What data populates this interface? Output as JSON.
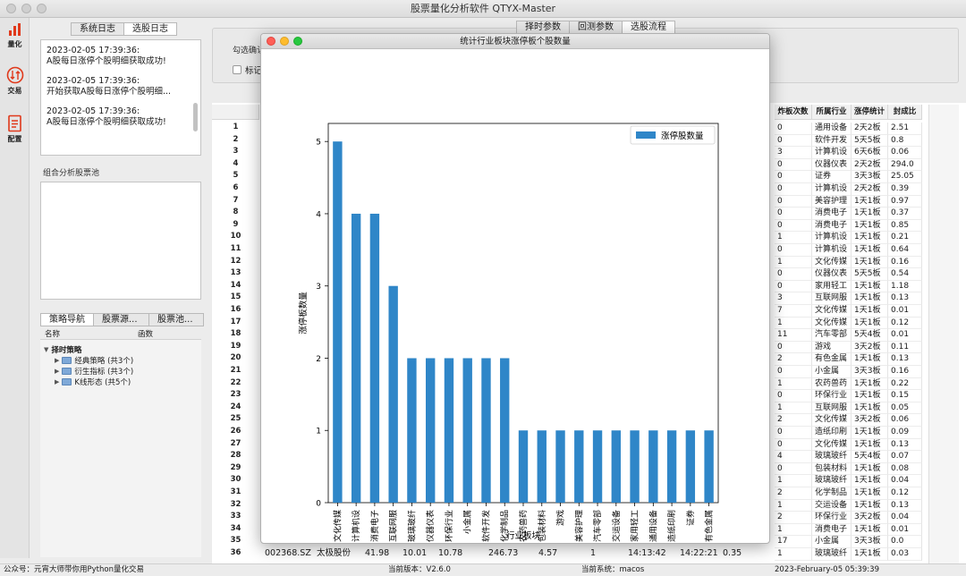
{
  "window": {
    "title": "股票量化分析软件 QTYX-Master"
  },
  "iconbar": [
    {
      "label": "量化",
      "icon": "bar-chart-icon"
    },
    {
      "label": "交易",
      "icon": "trade-arrows-icon"
    },
    {
      "label": "配置",
      "icon": "document-icon"
    }
  ],
  "left": {
    "log_tabs": [
      "系统日志",
      "选股日志"
    ],
    "log_entries": [
      {
        "time": "2023-02-05 17:39:36:",
        "text": "A股每日涨停个股明细获取成功!"
      },
      {
        "time": "2023-02-05 17:39:36:",
        "text": "开始获取A股每日涨停个股明细..."
      },
      {
        "time": "2023-02-05 17:39:36:",
        "text": "A股每日涨停个股明细获取成功!"
      }
    ],
    "pool_label": "组合分析股票池",
    "nav_tabs": [
      "策略导航",
      "股票源...",
      "股票池..."
    ],
    "tree_headers": [
      "名称",
      "函数"
    ],
    "tree_root": "择时策略",
    "tree_children": [
      "经典策略 (共3个)",
      "衍生指标 (共3个)",
      "K线形态 (共5个)"
    ]
  },
  "right": {
    "tabs": [
      "择时参数",
      "回测参数",
      "选股流程"
    ],
    "confirm_label": "勾选确认",
    "checkbox_label": "标记",
    "headers": [
      "炸板次数",
      "所属行业",
      "涨停统计",
      "封成比"
    ],
    "row_numbers": [
      "1",
      "2",
      "3",
      "4",
      "5",
      "6",
      "7",
      "8",
      "9",
      "10",
      "11",
      "12",
      "13",
      "14",
      "15",
      "16",
      "17",
      "18",
      "19",
      "20",
      "21",
      "22",
      "23",
      "24",
      "25",
      "26",
      "27",
      "28",
      "29",
      "30",
      "31",
      "32",
      "33",
      "34",
      "35",
      "36"
    ],
    "rows": [
      [
        "0",
        "通用设备",
        "2天2板",
        "2.51"
      ],
      [
        "0",
        "软件开发",
        "5天5板",
        "0.8"
      ],
      [
        "3",
        "计算机设",
        "6天6板",
        "0.06"
      ],
      [
        "0",
        "仪器仪表",
        "2天2板",
        "294.0"
      ],
      [
        "0",
        "证券",
        "3天3板",
        "25.05"
      ],
      [
        "0",
        "计算机设",
        "2天2板",
        "0.39"
      ],
      [
        "0",
        "美容护理",
        "1天1板",
        "0.97"
      ],
      [
        "0",
        "消费电子",
        "1天1板",
        "0.37"
      ],
      [
        "0",
        "消费电子",
        "1天1板",
        "0.85"
      ],
      [
        "1",
        "计算机设",
        "1天1板",
        "0.21"
      ],
      [
        "0",
        "计算机设",
        "1天1板",
        "0.64"
      ],
      [
        "1",
        "文化传媒",
        "1天1板",
        "0.16"
      ],
      [
        "0",
        "仪器仪表",
        "5天5板",
        "0.54"
      ],
      [
        "0",
        "家用轻工",
        "1天1板",
        "1.18"
      ],
      [
        "3",
        "互联网服",
        "1天1板",
        "0.13"
      ],
      [
        "7",
        "文化传媒",
        "1天1板",
        "0.01"
      ],
      [
        "1",
        "文化传媒",
        "1天1板",
        "0.12"
      ],
      [
        "11",
        "汽车零部",
        "5天4板",
        "0.01"
      ],
      [
        "0",
        "游戏",
        "3天2板",
        "0.11"
      ],
      [
        "2",
        "有色金属",
        "1天1板",
        "0.13"
      ],
      [
        "0",
        "小金属",
        "3天3板",
        "0.16"
      ],
      [
        "1",
        "农药兽药",
        "1天1板",
        "0.22"
      ],
      [
        "0",
        "环保行业",
        "1天1板",
        "0.15"
      ],
      [
        "1",
        "互联网服",
        "1天1板",
        "0.05"
      ],
      [
        "2",
        "文化传媒",
        "3天2板",
        "0.06"
      ],
      [
        "0",
        "造纸印刷",
        "1天1板",
        "0.09"
      ],
      [
        "0",
        "文化传媒",
        "1天1板",
        "0.13"
      ],
      [
        "4",
        "玻璃玻纤",
        "5天4板",
        "0.07"
      ],
      [
        "0",
        "包装材料",
        "1天1板",
        "0.08"
      ],
      [
        "1",
        "玻璃玻纤",
        "1天1板",
        "0.04"
      ],
      [
        "2",
        "化学制品",
        "1天1板",
        "0.12"
      ],
      [
        "1",
        "交运设备",
        "1天1板",
        "0.13"
      ],
      [
        "2",
        "环保行业",
        "3天2板",
        "0.04"
      ],
      [
        "1",
        "消费电子",
        "1天1板",
        "0.01"
      ],
      [
        "17",
        "小金属",
        "3天3板",
        "0.0"
      ],
      [
        "1",
        "玻璃玻纤",
        "1天1板",
        "0.03"
      ]
    ],
    "last_row": [
      "002368.SZ",
      "太极股份",
      "41.98",
      "10.01",
      "10.78",
      "246.73",
      "4.57",
      "1",
      "14:13:42",
      "14:22:21",
      "0.35"
    ]
  },
  "popup": {
    "title": "统计行业板块涨停板个股数量"
  },
  "chart_data": {
    "type": "bar",
    "categories": [
      "文化传媒",
      "计算机设",
      "消费电子",
      "互联网服",
      "玻璃玻纤",
      "仪器仪表",
      "环保行业",
      "小金属",
      "软件开发",
      "化学制品",
      "农药兽药",
      "包装材料",
      "游戏",
      "美容护理",
      "汽车零部",
      "交运设备",
      "家用轻工",
      "通用设备",
      "造纸印刷",
      "证券",
      "有色金属"
    ],
    "series": [
      {
        "name": "涨停股数量",
        "values": [
          5,
          4,
          4,
          3,
          2,
          2,
          2,
          2,
          2,
          2,
          1,
          1,
          1,
          1,
          1,
          1,
          1,
          1,
          1,
          1,
          1
        ]
      }
    ],
    "xlabel": "行业板块",
    "ylabel": "涨停板数量",
    "ylim": [
      0,
      5.25
    ],
    "yticks": [
      "0",
      "1",
      "2",
      "3",
      "4",
      "5"
    ],
    "legend": "top-right",
    "color": "#2f86c8"
  },
  "status": {
    "left": "公众号：元宵大师带你用Python量化交易",
    "version": "当前版本：V2.6.0",
    "system": "当前系统：macos",
    "datetime": "2023-February-05 05:39:39"
  }
}
